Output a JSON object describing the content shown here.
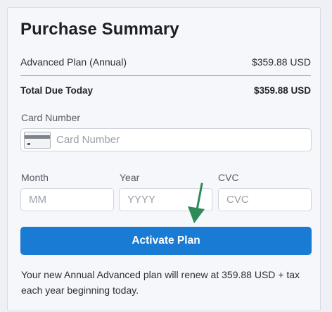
{
  "summary": {
    "title": "Purchase Summary",
    "plan_label": "Advanced Plan (Annual)",
    "plan_price": "$359.88 USD",
    "total_label": "Total Due Today",
    "total_price": "$359.88 USD"
  },
  "payment": {
    "card_number_label": "Card Number",
    "card_number_placeholder": "Card Number",
    "card_number_value": "",
    "month_label": "Month",
    "month_placeholder": "MM",
    "year_label": "Year",
    "year_placeholder": "YYYY",
    "cvc_label": "CVC",
    "cvc_placeholder": "CVC"
  },
  "action": {
    "activate_label": "Activate Plan"
  },
  "footer": {
    "renewal_note": "Your new Annual Advanced plan will renew at 359.88 USD + tax each year beginning today."
  },
  "icons": {
    "card": "credit-card-icon",
    "pointer": "arrow-down-icon"
  },
  "colors": {
    "primary": "#1a7bd4",
    "arrow": "#2e8b57"
  }
}
